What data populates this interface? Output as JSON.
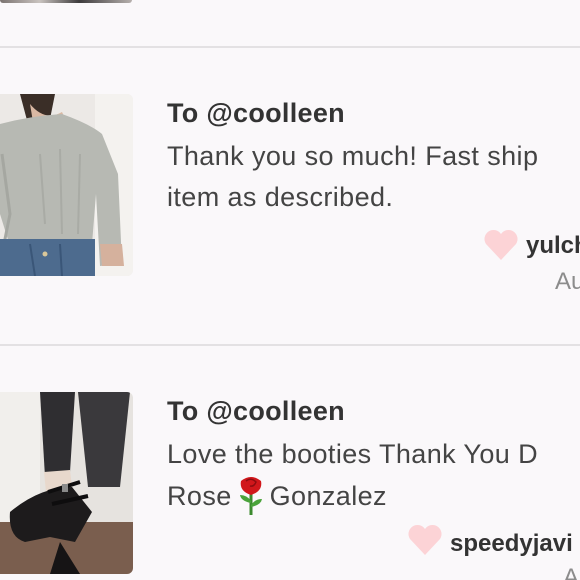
{
  "reviews": [
    {
      "to": "To @coolleen",
      "message_lines": [
        "Thank you so much! Fast ship",
        "item as described."
      ],
      "username": "yulch",
      "date": "Au",
      "thumbnail_icon": "sweater-listing-photo"
    },
    {
      "to": "To @coolleen",
      "message_lines": [
        "Love the booties Thank You D",
        "Rose",
        "Gonzalez"
      ],
      "emoji": "rose",
      "username": "speedyjavi",
      "date": "Au",
      "thumbnail_icon": "booties-listing-photo"
    }
  ],
  "colors": {
    "heart": "#fcd3d6",
    "divider": "#e3e1e3",
    "background": "#faf8fa"
  }
}
